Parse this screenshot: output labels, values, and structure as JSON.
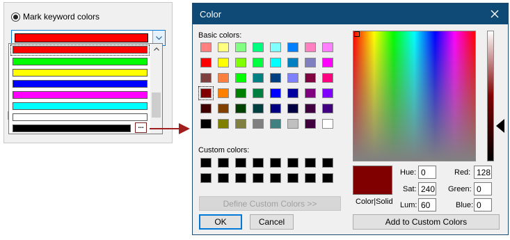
{
  "left_panel": {
    "radio_label": "Mark keyword colors",
    "combo_value_color": "#ff0000",
    "dropdown_colors": [
      "#ff0000",
      "#00ff00",
      "#ffff00",
      "#0000ff",
      "#ff00ff",
      "#00ffff",
      "#ffffff",
      "#000000"
    ],
    "more_button_label": "..."
  },
  "dialog": {
    "title": "Color",
    "close_icon": "close-icon",
    "basic_colors_label": "Basic colors:",
    "basic_colors": [
      [
        "#ff8080",
        "#ffff80",
        "#80ff80",
        "#00ff80",
        "#80ffff",
        "#0080ff",
        "#ff80c0",
        "#ff80ff"
      ],
      [
        "#ff0000",
        "#ffff00",
        "#80ff00",
        "#00ff40",
        "#00ffff",
        "#0080c0",
        "#8080c0",
        "#ff00ff"
      ],
      [
        "#804040",
        "#ff8040",
        "#00ff00",
        "#008080",
        "#004080",
        "#8080ff",
        "#800040",
        "#ff0080"
      ],
      [
        "#800000",
        "#ff8000",
        "#008000",
        "#008040",
        "#0000ff",
        "#0000a0",
        "#800080",
        "#8000ff"
      ],
      [
        "#400000",
        "#804000",
        "#004000",
        "#004040",
        "#000080",
        "#000040",
        "#400040",
        "#400080"
      ],
      [
        "#000000",
        "#808000",
        "#808040",
        "#808080",
        "#408080",
        "#c0c0c0",
        "#400040",
        "#ffffff"
      ]
    ],
    "selected_basic": "#800000",
    "custom_colors_label": "Custom colors:",
    "custom_colors": [
      "#000000",
      "#000000",
      "#000000",
      "#000000",
      "#000000",
      "#000000",
      "#000000",
      "#000000",
      "#000000",
      "#000000",
      "#000000",
      "#000000",
      "#000000",
      "#000000",
      "#000000",
      "#000000"
    ],
    "define_custom_label": "Define Custom Colors >>",
    "ok_label": "OK",
    "cancel_label": "Cancel",
    "preview_color": "#800000",
    "color_solid_label": "Color|Solid",
    "hue_label": "Hue:",
    "hue_value": "0",
    "sat_label": "Sat:",
    "sat_value": "240",
    "lum_label": "Lum:",
    "lum_value": "60",
    "red_label": "Red:",
    "red_value": "128",
    "green_label": "Green:",
    "green_value": "0",
    "blue_label": "Blue:",
    "blue_value": "0",
    "add_custom_label": "Add to Custom Colors"
  },
  "connector_color": "#a01e1e"
}
